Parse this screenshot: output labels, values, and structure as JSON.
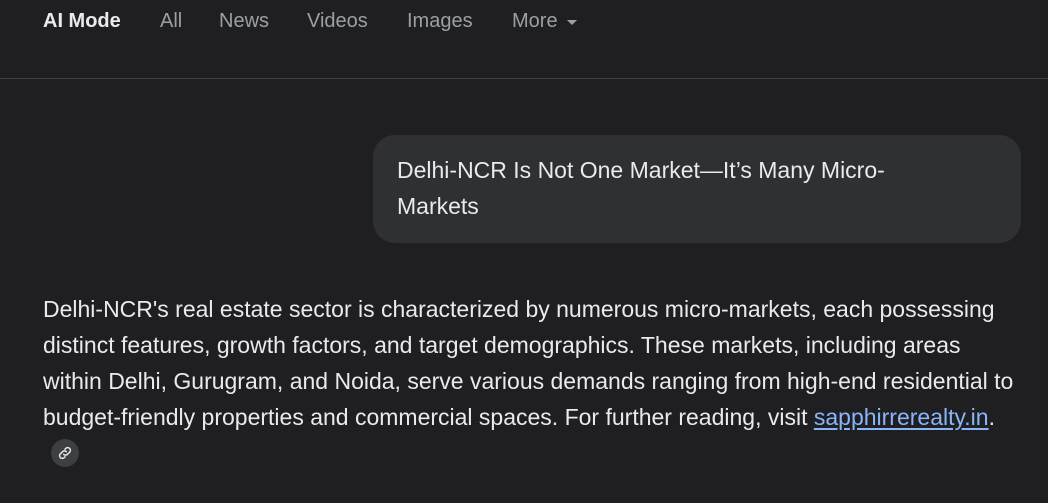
{
  "tabs": {
    "items": [
      {
        "label": "AI Mode",
        "active": true
      },
      {
        "label": "All"
      },
      {
        "label": "News"
      },
      {
        "label": "Videos"
      },
      {
        "label": "Images"
      },
      {
        "label": "More"
      }
    ]
  },
  "query": {
    "text": "Delhi-NCR Is Not One Market—It’s Many Micro-Markets"
  },
  "answer": {
    "text_before_link": "Delhi-NCR's real estate sector is characterized by numerous micro-markets, each possessing distinct features, growth factors, and target demographics. These markets, including areas within Delhi, Gurugram, and Noida, serve various demands ranging from high-end residential to budget-friendly properties and commercial spaces. For further reading, visit ",
    "link_text": "sapphirrerealty.in",
    "text_after_link": ".",
    "link_chip_icon": "link-icon"
  },
  "colors": {
    "background": "#1f1f21",
    "bubble": "#2f3033",
    "text": "#e8eaed",
    "muted": "#9aa0a6",
    "link": "#8ab4f8"
  }
}
